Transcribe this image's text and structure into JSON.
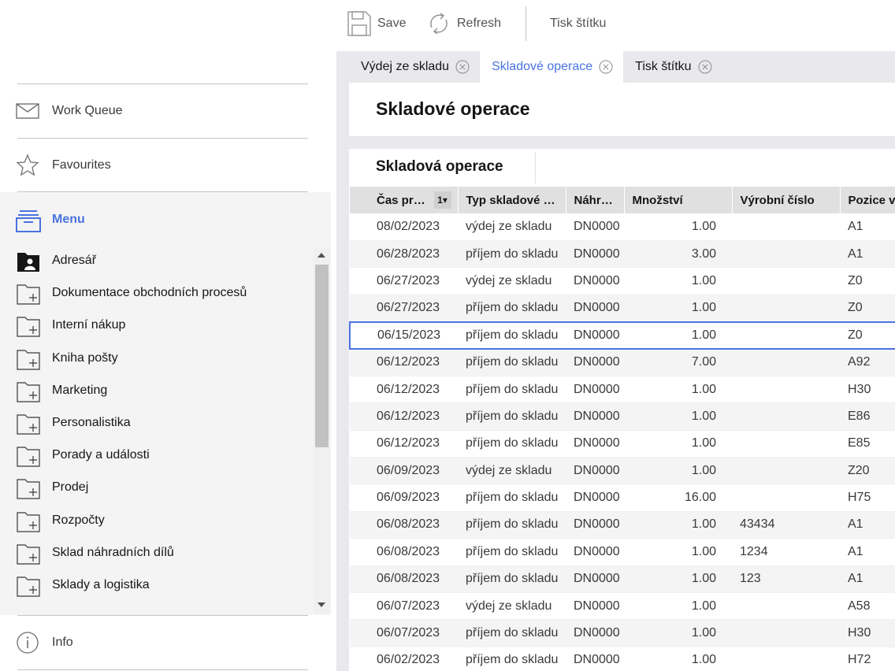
{
  "toolbar": {
    "save_label": "Save",
    "refresh_label": "Refresh",
    "print_label": "Tisk štítku"
  },
  "sidebar": {
    "work_queue": "Work Queue",
    "favourites": "Favourites",
    "menu": "Menu",
    "info": "Info",
    "items": [
      {
        "label": "Adresář",
        "icon": "folder-person-icon"
      },
      {
        "label": "Dokumentace obchodních procesů",
        "icon": "folder-add-icon"
      },
      {
        "label": "Interní nákup",
        "icon": "folder-add-icon"
      },
      {
        "label": "Kniha pošty",
        "icon": "folder-add-icon"
      },
      {
        "label": "Marketing",
        "icon": "folder-add-icon"
      },
      {
        "label": "Personalistika",
        "icon": "folder-add-icon"
      },
      {
        "label": "Porady a události",
        "icon": "folder-add-icon"
      },
      {
        "label": "Prodej",
        "icon": "folder-add-icon"
      },
      {
        "label": "Rozpočty",
        "icon": "folder-add-icon"
      },
      {
        "label": "Sklad náhradních dílů",
        "icon": "folder-add-icon"
      },
      {
        "label": "Sklady a logistika",
        "icon": "folder-add-icon"
      }
    ]
  },
  "tabs": [
    {
      "label": "Výdej ze skladu",
      "active": false
    },
    {
      "label": "Skladové operace",
      "active": true
    },
    {
      "label": "Tisk štítku",
      "active": false
    }
  ],
  "page_title": "Skladové operace",
  "panel_title": "Skladová operace",
  "table": {
    "columns": [
      "Čas provedení",
      "Typ skladové operace",
      "Náhradní díl",
      "Množství",
      "Výrobní číslo",
      "Pozice v"
    ],
    "sort_indicator": "1",
    "rows": [
      [
        "08/02/2023",
        "výdej ze skladu",
        "DN0000",
        "1.00",
        "",
        "A1"
      ],
      [
        "06/28/2023",
        "příjem do skladu",
        "DN0000",
        "3.00",
        "",
        "A1"
      ],
      [
        "06/27/2023",
        "výdej ze skladu",
        "DN0000",
        "1.00",
        "",
        "Z0"
      ],
      [
        "06/27/2023",
        "příjem do skladu",
        "DN0000",
        "1.00",
        "",
        "Z0"
      ],
      [
        "06/15/2023",
        "příjem do skladu",
        "DN0000",
        "1.00",
        "",
        "Z0"
      ],
      [
        "06/12/2023",
        "příjem do skladu",
        "DN0000",
        "7.00",
        "",
        "A92"
      ],
      [
        "06/12/2023",
        "příjem do skladu",
        "DN0000",
        "1.00",
        "",
        "H30"
      ],
      [
        "06/12/2023",
        "příjem do skladu",
        "DN0000",
        "1.00",
        "",
        "E86"
      ],
      [
        "06/12/2023",
        "příjem do skladu",
        "DN0000",
        "1.00",
        "",
        "E85"
      ],
      [
        "06/09/2023",
        "výdej ze skladu",
        "DN0000",
        "1.00",
        "",
        "Z20"
      ],
      [
        "06/09/2023",
        "příjem do skladu",
        "DN0000",
        "16.00",
        "",
        "H75"
      ],
      [
        "06/08/2023",
        "příjem do skladu",
        "DN0000",
        "1.00",
        "43434",
        "A1"
      ],
      [
        "06/08/2023",
        "příjem do skladu",
        "DN0000",
        "1.00",
        "1234",
        "A1"
      ],
      [
        "06/08/2023",
        "příjem do skladu",
        "DN0000",
        "1.00",
        "123",
        "A1"
      ],
      [
        "06/07/2023",
        "výdej ze skladu",
        "DN0000",
        "1.00",
        "",
        "A58"
      ],
      [
        "06/07/2023",
        "příjem do skladu",
        "DN0000",
        "1.00",
        "",
        "H30"
      ],
      [
        "06/02/2023",
        "příjem do skladu",
        "DN0000",
        "1.00",
        "",
        "H72"
      ]
    ],
    "selected_row": 4
  },
  "colors": {
    "accent": "#4a73e0",
    "header_bg": "#e0e0e0",
    "alt_row": "#f4f4f4",
    "main_bg": "#e8e8ed"
  }
}
